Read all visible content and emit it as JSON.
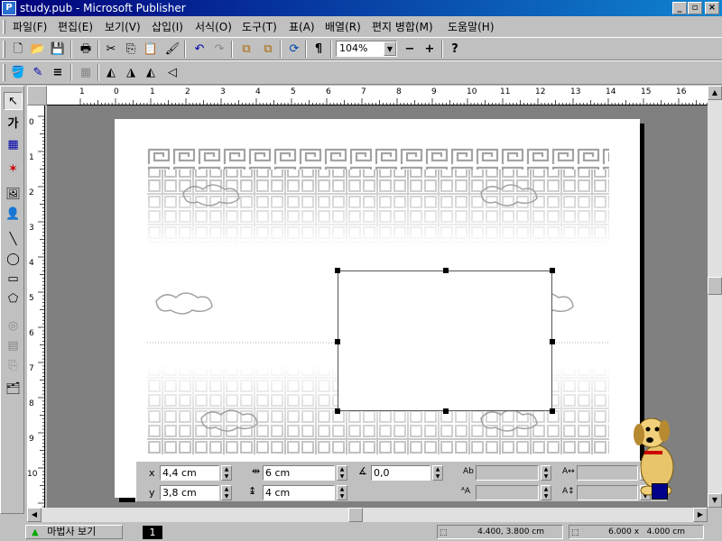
{
  "window": {
    "title": "study.pub - Microsoft Publisher",
    "app_icon": "P",
    "minimize": "_",
    "maximize": "▫",
    "close": "×"
  },
  "menu": [
    "파일(F)",
    "편집(E)",
    "보기(V)",
    "삽입(I)",
    "서식(O)",
    "도구(T)",
    "표(A)",
    "배열(R)",
    "편지 병합(M)",
    "도움말(H)"
  ],
  "toolbar_standard": {
    "zoom": "104%"
  },
  "rulers": {
    "horizontal": [
      "1",
      "0",
      "1",
      "2",
      "3",
      "4",
      "5",
      "6",
      "7",
      "8",
      "9",
      "10",
      "11",
      "12",
      "13",
      "14",
      "15",
      "16"
    ],
    "vertical": [
      "0",
      "1",
      "2",
      "3",
      "4",
      "5",
      "6",
      "7",
      "8",
      "9",
      "10"
    ]
  },
  "measurements": {
    "x_label": "x",
    "x_value": "4,4 cm",
    "y_label": "y",
    "y_value": "3,8 cm",
    "width_value": "6 cm",
    "height_value": "4 cm",
    "angle_value": "0,0"
  },
  "status": {
    "wizard_label": "마법사 보기",
    "page_number": "1",
    "position": "4.400, 3.800 cm",
    "size": "6.000 x   4.000 cm"
  },
  "colors": {
    "title_bar": "#00007b",
    "workspace": "#808080",
    "assistant_swatch": "#00008b"
  }
}
